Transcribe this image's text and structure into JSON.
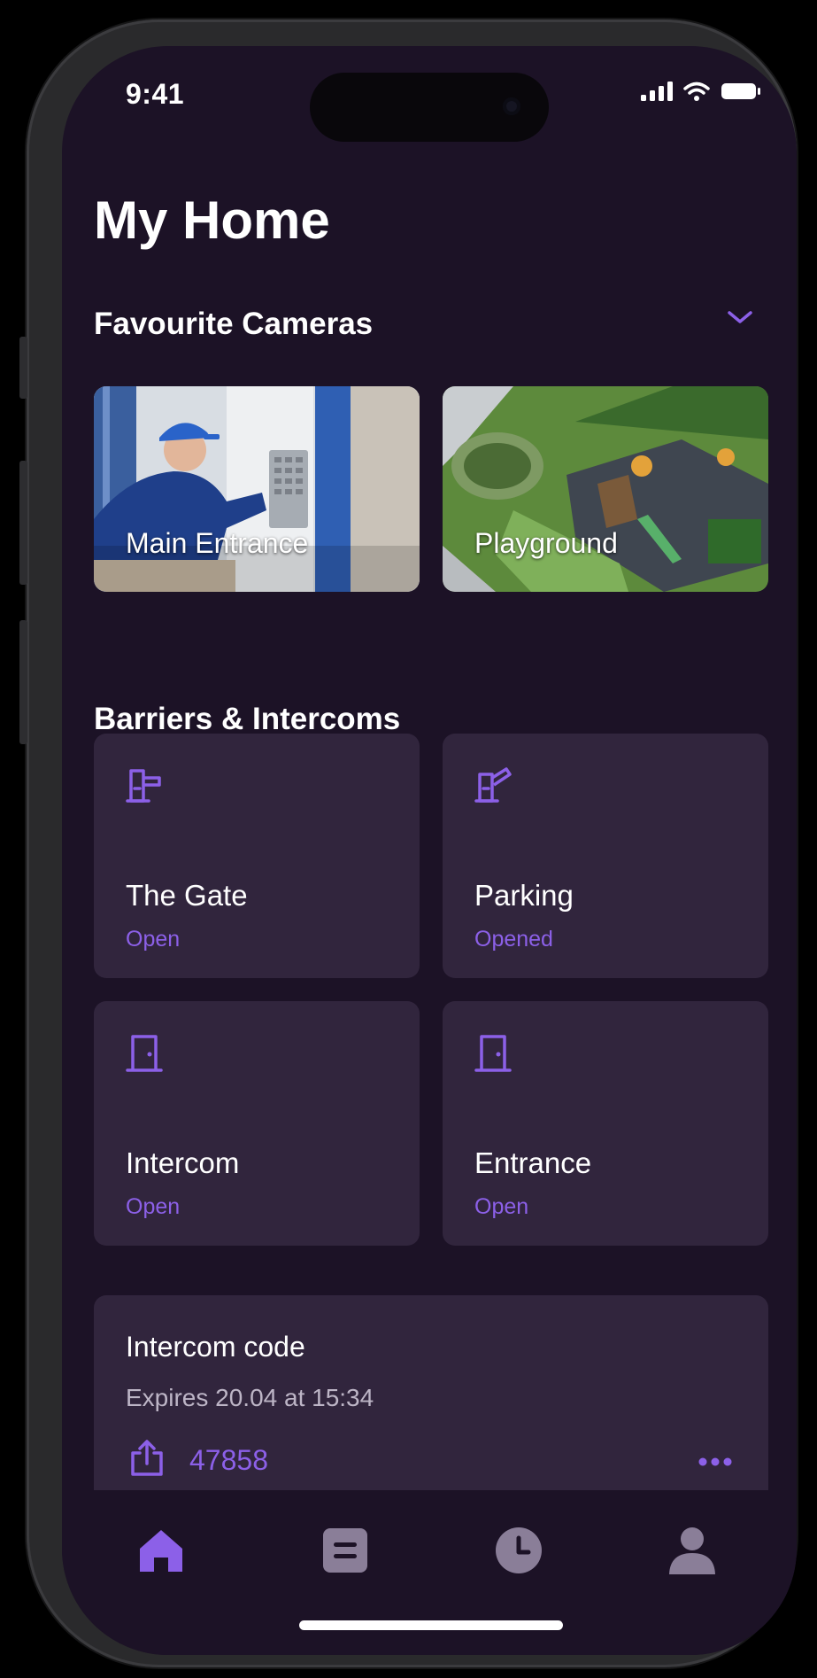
{
  "status_bar": {
    "time": "9:41"
  },
  "header": {
    "title": "My Home"
  },
  "favourites": {
    "title": "Favourite Cameras",
    "cameras": [
      {
        "label": "Main Entrance"
      },
      {
        "label": "Playground"
      }
    ]
  },
  "barriers": {
    "title": "Barriers & Intercoms",
    "tiles": [
      {
        "name": "The Gate",
        "status": "Open",
        "icon": "barrier-gate-icon"
      },
      {
        "name": "Parking",
        "status": "Opened",
        "icon": "barrier-gate-raised-icon"
      },
      {
        "name": "Intercom",
        "status": "Open",
        "icon": "door-icon"
      },
      {
        "name": "Entrance",
        "status": "Open",
        "icon": "door-icon"
      }
    ]
  },
  "intercom_code": {
    "title": "Intercom code",
    "expiry": "Expires 20.04 at 15:34",
    "code": "47858"
  },
  "tabbar": {
    "items": [
      {
        "icon": "home-icon",
        "active": true
      },
      {
        "icon": "list-icon",
        "active": false
      },
      {
        "icon": "clock-icon",
        "active": false
      },
      {
        "icon": "profile-icon",
        "active": false
      }
    ]
  },
  "colors": {
    "background": "#1c1226",
    "card": "#31253d",
    "accent": "#8c60e8",
    "inactive_icon": "#8a7e98"
  }
}
